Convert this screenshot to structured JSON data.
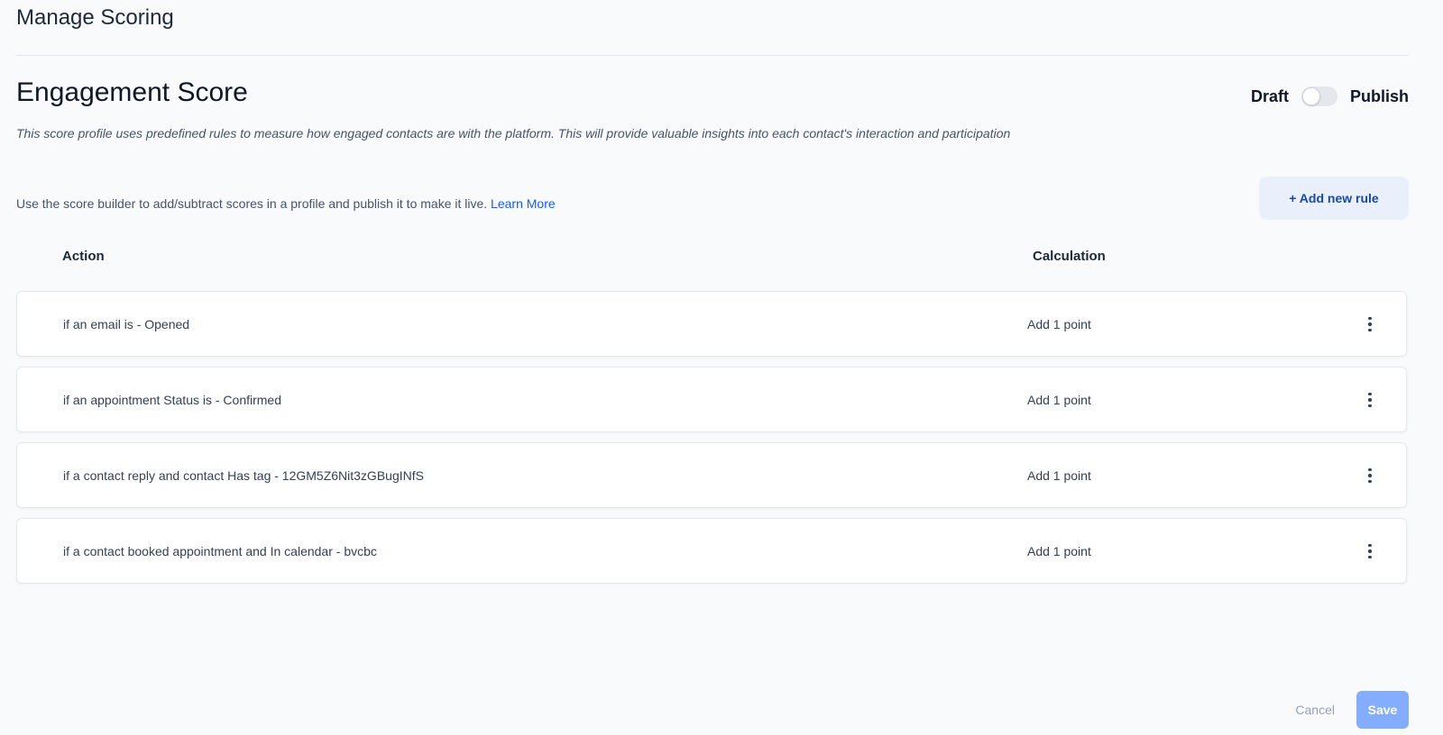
{
  "page": {
    "title": "Manage Scoring"
  },
  "profile": {
    "name": "Engagement Score",
    "description": "This score profile uses predefined rules to measure how engaged contacts are with the platform. This will provide valuable insights into each contact's interaction and participation"
  },
  "status_toggle": {
    "draft_label": "Draft",
    "publish_label": "Publish",
    "state": "draft"
  },
  "builder": {
    "hint": "Use the score builder to add/subtract scores in a profile and publish it to make it live.",
    "learn_more": "Learn More",
    "add_rule_label": "+ Add new rule"
  },
  "table": {
    "headers": {
      "action": "Action",
      "calculation": "Calculation"
    },
    "rows": [
      {
        "action": "if an email is - Opened",
        "calculation": "Add 1 point"
      },
      {
        "action": "if an appointment Status is - Confirmed",
        "calculation": "Add 1 point"
      },
      {
        "action": "if a contact reply and contact Has tag - 12GM5Z6Nit3zGBugINfS",
        "calculation": "Add 1 point"
      },
      {
        "action": "if a contact booked appointment and In calendar - bvcbc",
        "calculation": "Add 1 point"
      }
    ],
    "row_menu_icon": "more-vertical-icon"
  },
  "footer": {
    "cancel_label": "Cancel",
    "save_label": "Save"
  },
  "colors": {
    "accent": "#155eef",
    "add_rule_bg": "#eaf0fb",
    "save_bg": "#84adff",
    "background": "#f9fafb"
  }
}
